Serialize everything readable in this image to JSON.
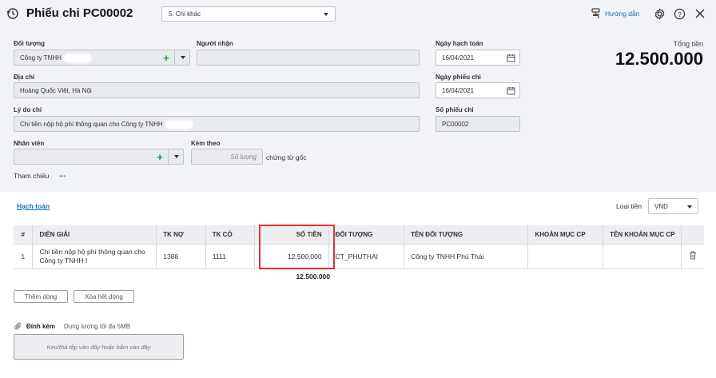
{
  "header": {
    "title": "Phiếu chi PC00002",
    "type_select": "5. Chi khác",
    "guide_link": "Hướng dẫn"
  },
  "form": {
    "doi_tuong": {
      "label": "Đối tượng",
      "value": "Công ty TNHH"
    },
    "nguoi_nhan": {
      "label": "Người nhận",
      "value": ""
    },
    "dia_chi": {
      "label": "Địa chỉ",
      "value": "Hoàng Quốc Việt, Hà Nội"
    },
    "ly_do_chi": {
      "label": "Lý do chi",
      "value": "Chi tiền nộp hộ phí thông quan cho Công ty TNHH"
    },
    "nhan_vien": {
      "label": "Nhân viên",
      "value": ""
    },
    "kem_theo": {
      "label": "Kèm theo",
      "placeholder": "Số lượng",
      "suffix": "chứng từ gốc"
    },
    "tham_chieu": {
      "label": "Tham chiếu",
      "more": "..."
    },
    "ngay_hach_toan": {
      "label": "Ngày hạch toán",
      "value": "16/04/2021"
    },
    "ngay_phieu_chi": {
      "label": "Ngày phiếu chi",
      "value": "16/04/2021"
    },
    "so_phieu_chi": {
      "label": "Số phiếu chi",
      "value": "PC00002"
    }
  },
  "total": {
    "label": "Tổng tiền",
    "value": "12.500.000"
  },
  "tabs": {
    "hach_toan": "Hạch toán"
  },
  "currency": {
    "label": "Loại tiền",
    "value": "VND"
  },
  "table": {
    "headers": [
      "#",
      "DIỄN GIẢI",
      "TK NỢ",
      "TK CÓ",
      "SỐ TIỀN",
      "ĐỐI TƯỢNG",
      "TÊN ĐỐI TƯỢNG",
      "KHOẢN MỤC CP",
      "TÊN KHOẢN MỤC CP"
    ],
    "rows": [
      {
        "no": "1",
        "dien_giai": "Chi tiền nộp hộ phí thông quan cho Công ty TNHH I",
        "tk_no": "1388",
        "tk_co": "1111",
        "so_tien": "12.500.000",
        "doi_tuong": "CT_PHUTHAI",
        "ten_doi_tuong": "Công ty TNHH Phú Thái",
        "khoan_muc": "",
        "ten_khoan_muc": ""
      }
    ],
    "footer_total": "12.500.000"
  },
  "actions": {
    "add_row": "Thêm dòng",
    "delete_all": "Xóa hết dòng"
  },
  "attachment": {
    "label": "Đính kèm",
    "hint": "Dung lượng tối đa 5MB",
    "dropzone": "Kéo/thả tệp vào đây hoặc bấm vào đây"
  },
  "colors": {
    "accent": "#0b74c8",
    "highlight_border": "#e0322f",
    "plus_green": "#1d9b2c"
  },
  "icons": [
    "history-icon",
    "guide-icon",
    "gear-icon",
    "help-icon",
    "close-icon",
    "calendar-icon",
    "plus-icon",
    "trash-icon",
    "paperclip-icon"
  ]
}
